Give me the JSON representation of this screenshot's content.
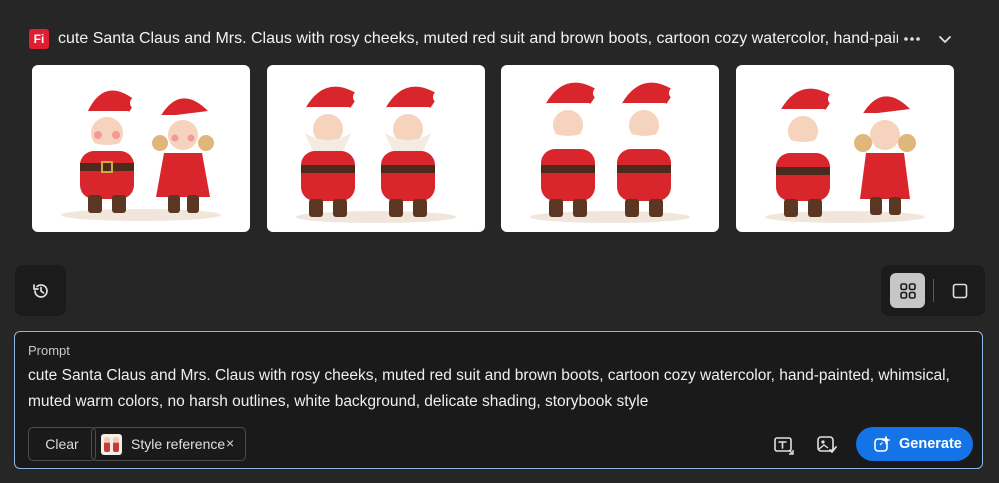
{
  "header": {
    "logo_text": "Fi",
    "title": "cute Santa Claus and Mrs. Claus with rosy cheeks, muted red suit and brown boots, cartoon cozy watercolor, hand-painted",
    "more_icon": "more-horizontal-icon",
    "chevron_icon": "chevron-down-icon"
  },
  "gallery": {
    "items": [
      {
        "name": "result-1",
        "pair": "santa-and-mrs-claus"
      },
      {
        "name": "result-2",
        "pair": "two-santas"
      },
      {
        "name": "result-3",
        "pair": "two-santas"
      },
      {
        "name": "result-4",
        "pair": "santa-and-mrs-claus"
      }
    ]
  },
  "controls": {
    "history_icon": "history-icon",
    "grid_icon": "grid-view-icon",
    "single_icon": "single-view-icon"
  },
  "prompt": {
    "label": "Prompt",
    "text": "cute Santa Claus and Mrs. Claus with rosy cheeks, muted red suit and brown boots, cartoon cozy watercolor, hand-painted, whimsical, muted warm colors, no harsh outlines, white background, delicate shading, storybook style",
    "clear_label": "Clear",
    "style_reference_label": "Style reference",
    "close_glyph": "×",
    "generate_label": "Generate"
  },
  "colors": {
    "background": "#262626",
    "panel": "#1a1a1a",
    "accent": "#1473e6",
    "focus_border": "#8db6e8",
    "brand_red": "#e11d2f"
  }
}
